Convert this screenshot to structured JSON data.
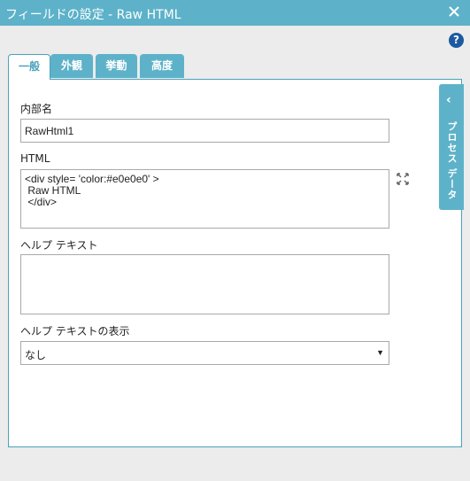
{
  "window": {
    "title": "フィールドの設定 - Raw HTML"
  },
  "help": {
    "symbol": "?"
  },
  "tabs": [
    {
      "label": "一般",
      "active": true
    },
    {
      "label": "外観",
      "active": false
    },
    {
      "label": "挙動",
      "active": false
    },
    {
      "label": "高度",
      "active": false
    }
  ],
  "form": {
    "internal_name_label": "内部名",
    "internal_name_value": "RawHtml1",
    "html_label": "HTML",
    "html_value": "<div style= 'color:#e0e0e0' >\n Raw HTML\n </div>",
    "help_text_label": "ヘルプ テキスト",
    "help_text_value": "",
    "help_display_label": "ヘルプ テキストの表示",
    "help_display_value": "なし"
  },
  "side_panel": {
    "label": "プロセス データ",
    "chevron": "‹"
  },
  "colors": {
    "accent": "#5db2c9",
    "border": "#4aa3bd",
    "help_icon": "#1c5aa0"
  }
}
